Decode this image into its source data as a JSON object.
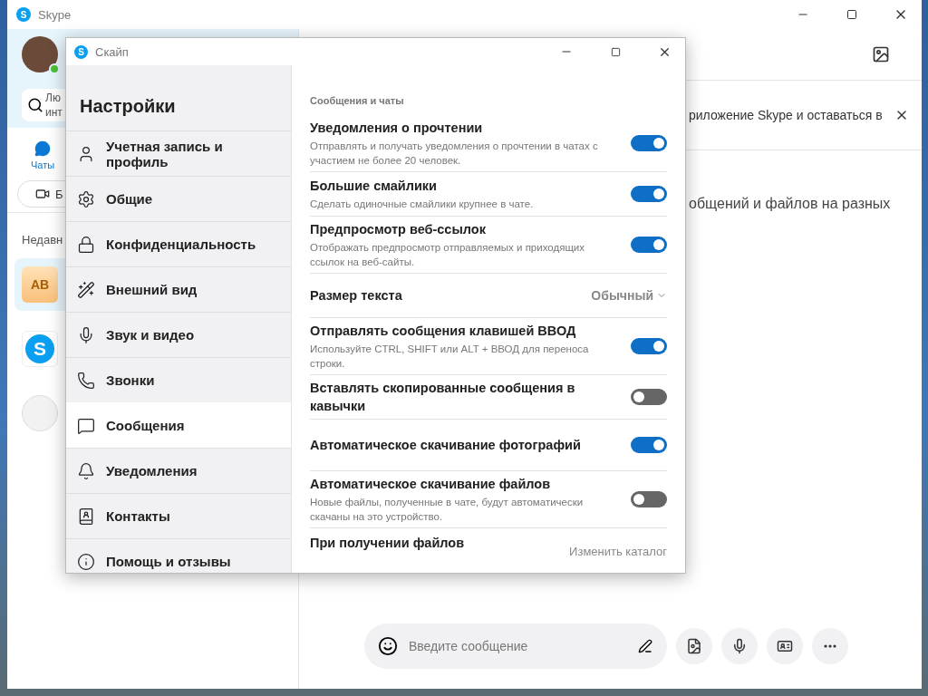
{
  "main_window": {
    "title": "Skype",
    "logo": "S",
    "user": {
      "online": true
    },
    "search": {
      "placeholder": "Лю инт"
    },
    "tabs": [
      {
        "label": "Чаты",
        "selected": true
      }
    ],
    "call_button": {
      "label": "Б"
    },
    "recent_label": "Недавн",
    "chats": [
      {
        "kind": "initials",
        "text": "AB",
        "selected": true
      },
      {
        "kind": "logo",
        "text": "S",
        "selected": false
      },
      {
        "kind": "picture",
        "selected": false
      }
    ],
    "banner": {
      "text": "риложение Skype и оставаться в"
    },
    "content_text": "общений и файлов на разных",
    "composer": {
      "placeholder": "Введите сообщение"
    }
  },
  "settings_dialog": {
    "title": "Скайп",
    "logo": "S",
    "heading": "Настройки",
    "nav": [
      {
        "kind": "account",
        "label": "Учетная запись и профиль",
        "selected": false
      },
      {
        "kind": "general",
        "label": "Общие",
        "selected": false
      },
      {
        "kind": "privacy",
        "label": "Конфиденциальность",
        "selected": false
      },
      {
        "kind": "appearance",
        "label": "Внешний вид",
        "selected": false
      },
      {
        "kind": "audio",
        "label": "Звук и видео",
        "selected": false
      },
      {
        "kind": "calls",
        "label": "Звонки",
        "selected": false
      },
      {
        "kind": "messages",
        "label": "Сообщения",
        "selected": true
      },
      {
        "kind": "notifications",
        "label": "Уведомления",
        "selected": false
      },
      {
        "kind": "contacts",
        "label": "Контакты",
        "selected": false
      },
      {
        "kind": "help",
        "label": "Помощь и отзывы",
        "selected": false
      }
    ],
    "section": "Сообщения и чаты",
    "settings": [
      {
        "kind": "toggle",
        "title": "Уведомления о прочтении",
        "description": "Отправлять и получать уведомления о прочтении в чатах с участием не более 20 человек.",
        "on": true
      },
      {
        "kind": "toggle",
        "title": "Большие смайлики",
        "description": "Сделать одиночные смайлики крупнее в чате.",
        "on": true
      },
      {
        "kind": "toggle",
        "title": "Предпросмотр веб-ссылок",
        "description": "Отображать предпросмотр отправляемых и приходящих ссылок на веб-сайты.",
        "on": true
      },
      {
        "kind": "dropdown",
        "title": "Размер текста",
        "value": "Обычный"
      },
      {
        "kind": "toggle",
        "title": "Отправлять сообщения клавишей ВВОД",
        "description": "Используйте CTRL, SHIFT или ALT + ВВОД для переноса строки.",
        "on": true
      },
      {
        "kind": "toggle",
        "title": "Вставлять скопированные сообщения в кавычки",
        "on": false
      },
      {
        "kind": "toggle",
        "title": "Автоматическое скачивание фотографий",
        "on": true
      },
      {
        "kind": "toggle",
        "title": "Автоматическое скачивание файлов",
        "description": "Новые файлы, полученные в чате, будут автоматически скачаны на это устройство.",
        "on": false
      },
      {
        "kind": "folder",
        "title": "При получении файлов",
        "action": "Изменить каталог"
      }
    ]
  }
}
